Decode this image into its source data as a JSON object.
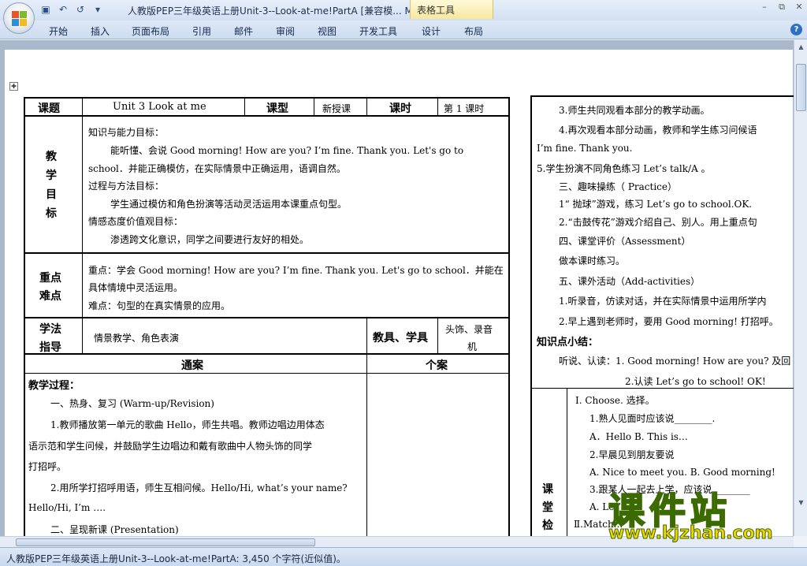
{
  "window": {
    "title": "人教版PEP三年级英语上册Unit-3--Look-at-me!PartA [兼容模...  M",
    "context_tab": "表格工具"
  },
  "ribbon": {
    "tabs": [
      "开始",
      "插入",
      "页面布局",
      "引用",
      "邮件",
      "审阅",
      "视图",
      "开发工具",
      "设计",
      "布局"
    ]
  },
  "table_left": {
    "header": {
      "lesson_label": "课题",
      "lesson_value": "Unit 3    Look at me",
      "type_label": "课型",
      "type_value": "新授课",
      "period_label": "课时",
      "period_value": "第 1 课时"
    },
    "goals": {
      "label_chars": [
        "教",
        "学",
        "目",
        "标"
      ],
      "lines": [
        "知识与能力目标：",
        "能听懂、会说  Good morning!  How  are  you? I’m  fine.  Thank  you.   Let's  go  to",
        "school．并能正确模仿，在实际情景中正确运用，语调自然。",
        "过程与方法目标：",
        "学生通过模仿和角色扮演等活动灵活运用本课重点句型。",
        "情感态度价值观目标：",
        "渗透跨文化意识，同学之间要进行友好的相处。"
      ]
    },
    "keypoints": {
      "label_chars": [
        "重点",
        "难点"
      ],
      "lines": [
        "重点：学会 Good morning!    How are you? I’m fine. Thank you. Let's go to school．并能在",
        "具体情境中灵活运用。",
        "难点：句型的在真实情景的应用。"
      ]
    },
    "method": {
      "label_chars": [
        "学法",
        "指导"
      ],
      "value": "情景教学、角色表演",
      "tools_label": "教具、学具",
      "tools_value_lines": [
        "头饰、录音",
        "机"
      ]
    },
    "plan_headers": {
      "common": "通案",
      "individual": "个案"
    },
    "process": {
      "lines": [
        "教学过程：",
        "一、热身、复习  (Warm-up/Revision)",
        "1.教师播放第一单元的歌曲  Hello，师生共唱。教师边唱边用体态",
        "语示范和学生问候，并鼓励学生边唱边和戴有歌曲中人物头饰的同学",
        "打招呼。",
        "2.用所学打招呼用语，师生互相问候。Hello/Hi, what’s your name?",
        "Hello/Hi, I’m    ….",
        "二、呈现新课  (Presentation)"
      ]
    }
  },
  "table_right": {
    "lines": [
      "3.师生共同观看本部分的教学动画。",
      "4.再次观看本部分动画，教师和学生练习问候语",
      "I’m fine. Thank you.",
      "5.学生扮演不同角色练习 Let’s talk/A  。",
      "三、趣味操练（  Practice）",
      "1“ 抛球”游戏，练习 Let’s go to school.OK.",
      "2.“击鼓传花”游戏介绍自己、别人。用上重点句",
      "四、课堂评价（Assessment）",
      "做本课时练习。",
      "五、课外活动（Add-activities）",
      "1.听录音，仿读对话，并在实际情景中运用所学内",
      "2.早上遇到老师时，要用 Good morning! 打招呼。",
      "知识点小结：",
      "听说、认读：1. Good morning! How are you? 及回",
      "2.认读 Let’s go to school!     OK!"
    ],
    "check_label_chars": [
      "课",
      "堂",
      "检"
    ],
    "check_lines": [
      "Ⅰ. Choose.  选择。",
      "1.熟人见面时应该说________.",
      "A．Hello      B. This is…",
      "2.早晨见到朋友要说",
      "A. Nice to meet you.     B. Good morning!",
      "3.跟某人一起去上学，应该说________",
      "A. Let’s...",
      "Ⅱ.Match..."
    ]
  },
  "status": {
    "text": "人教版PEP三年级英语上册Unit-3--Look-at-me!PartA: 3,450 个字符(近似值)。"
  },
  "watermark": {
    "title": "课件站",
    "url": "www.kjzhan.com"
  }
}
